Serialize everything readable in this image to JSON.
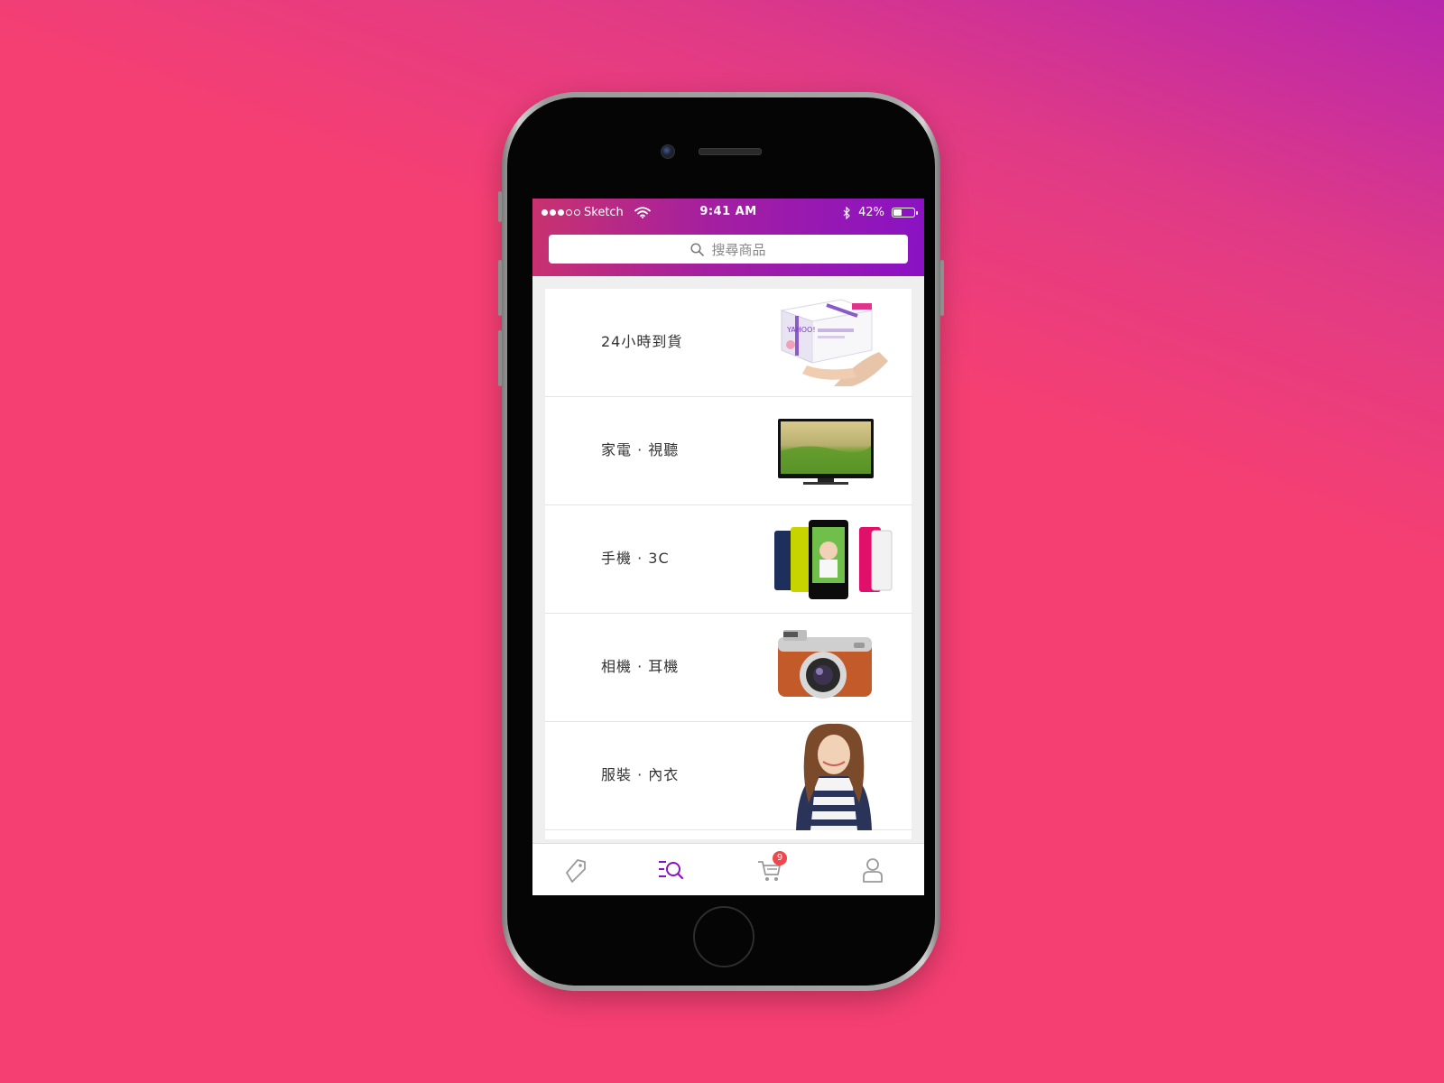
{
  "status_bar": {
    "carrier": "Sketch",
    "time": "9:41 AM",
    "battery_percent": "42%",
    "battery_level": 0.42,
    "signal_filled": 3,
    "signal_total": 5
  },
  "search": {
    "placeholder": "搜尋商品",
    "icon": "search-icon"
  },
  "categories": [
    {
      "label": "24小時到貨",
      "image": "delivery-box-in-hand"
    },
    {
      "label": "家電 · 視聽",
      "image": "flat-tv"
    },
    {
      "label": "手機 · 3C",
      "image": "colorful-smartphones"
    },
    {
      "label": "相機 · 耳機",
      "image": "brown-mirrorless-camera"
    },
    {
      "label": "服裝 · 內衣",
      "image": "woman-in-striped-top"
    }
  ],
  "tab_bar": {
    "tabs": [
      {
        "name": "deals",
        "icon": "tag-icon",
        "active": false
      },
      {
        "name": "categories",
        "icon": "category-search-icon",
        "active": true
      },
      {
        "name": "cart",
        "icon": "cart-icon",
        "active": false,
        "badge": "9"
      },
      {
        "name": "account",
        "icon": "user-icon",
        "active": false
      }
    ]
  },
  "colors": {
    "header_start": "#c9326f",
    "header_end": "#8a12c4",
    "active_tab": "#8a12c4",
    "badge": "#f0464e",
    "background": "#f53f73"
  }
}
